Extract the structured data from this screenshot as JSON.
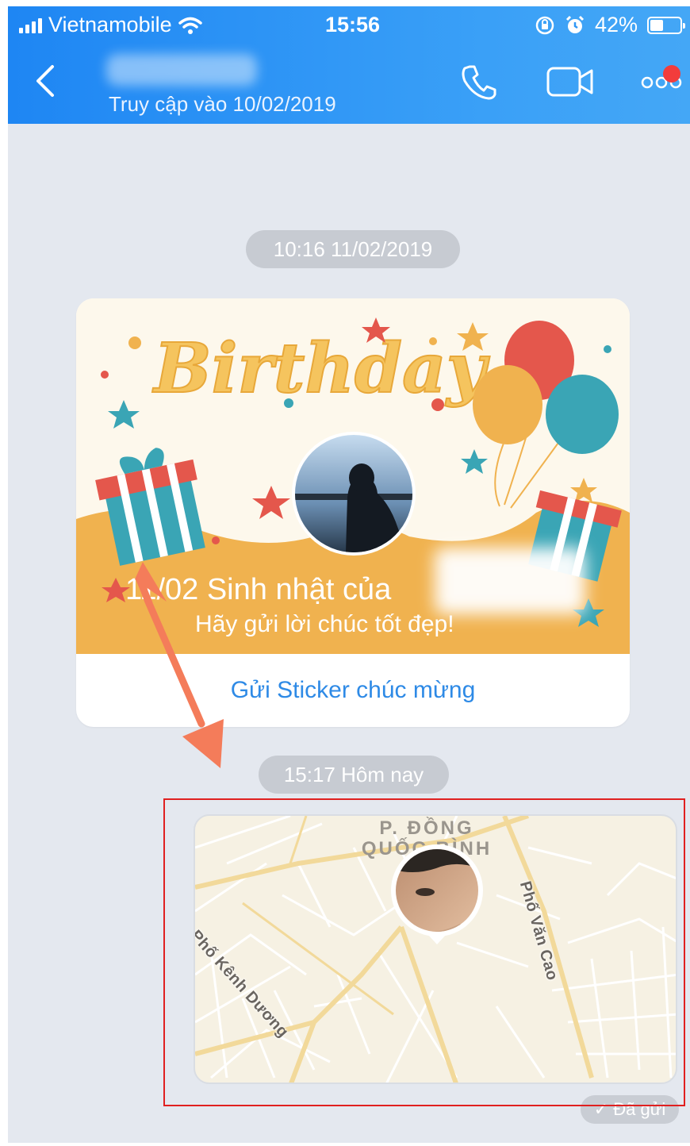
{
  "status_bar": {
    "carrier": "Vietnamobile",
    "time": "15:56",
    "battery": "42%",
    "icons": [
      "signal-bars-icon",
      "wifi-icon",
      "rotation-lock-icon",
      "alarm-icon",
      "battery-icon"
    ]
  },
  "header": {
    "back_icon": "chevron-left-icon",
    "last_seen": "Truy cập vào 10/02/2019",
    "actions": [
      "phone-icon",
      "video-call-icon",
      "more-icon"
    ],
    "notification_dot_color": "#f23c3c"
  },
  "chat": {
    "timestamp1": "10:16 11/02/2019",
    "birthday_card": {
      "title_art": "Birthday",
      "line1": "11/02 Sinh nhật của",
      "line2": "Hãy gửi lời chúc tốt đẹp!",
      "action": "Gửi Sticker chúc mừng"
    },
    "timestamp2": "15:17 Hôm nay",
    "location_map": {
      "district_line1": "P. ĐỒNG",
      "district_line2": "QUỐC BÌNH",
      "street1": "Phố Kênh Dương",
      "street2": "Phố Văn Cao"
    },
    "sent_status": "Đã gửi"
  },
  "colors": {
    "header_blue": "#2590f5",
    "chat_background": "#e4e8ef",
    "card_orange": "#f0b24f",
    "link_blue": "#2e8ae6",
    "annotation_red": "#e02020",
    "annotation_arrow": "#f47c5a"
  }
}
